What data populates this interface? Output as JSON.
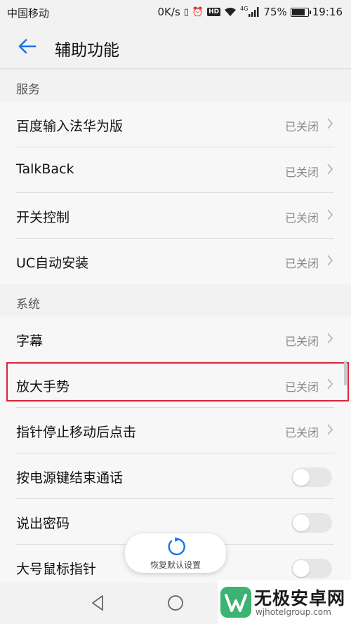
{
  "status_bar": {
    "carrier": "中国移动",
    "speed": "0K/s",
    "hd": "HD",
    "network": "4G",
    "battery_percent": "75%",
    "battery_level": 0.75,
    "time": "19:16"
  },
  "app_bar": {
    "title": "辅助功能",
    "back_icon": "arrow-left-icon",
    "accent": "#1a73e8"
  },
  "sections": [
    {
      "header": "服务"
    },
    {
      "header": "系统"
    }
  ],
  "rows": [
    {
      "label": "百度输入法华为版",
      "status": "已关闭"
    },
    {
      "label": "TalkBack",
      "status": "已关闭"
    },
    {
      "label": "开关控制",
      "status": "已关闭"
    },
    {
      "label": "UC自动安装",
      "status": "已关闭"
    },
    {
      "label": "字幕",
      "status": "已关闭"
    },
    {
      "label": "放大手势",
      "status": "已关闭"
    },
    {
      "label": "指针停止移动后点击",
      "status": "已关闭"
    }
  ],
  "toggles": [
    {
      "label": "按电源键结束通话",
      "on": false
    },
    {
      "label": "说出密码",
      "on": false
    },
    {
      "label": "大号鼠标指针",
      "on": false
    }
  ],
  "reset_button": {
    "label": "恢复默认设置",
    "icon": "refresh-icon",
    "color": "#1a73e8"
  },
  "highlight_color": "#d9263c",
  "watermark": {
    "title": "无极安卓网",
    "url": "wjhotelgroup.com",
    "logo_color": "#3cb371"
  }
}
